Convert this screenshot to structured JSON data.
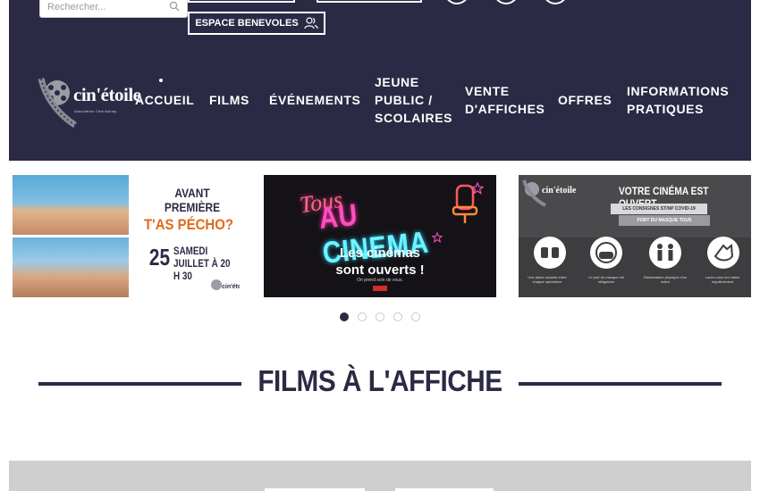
{
  "search": {
    "placeholder": "Rechercher..."
  },
  "header": {
    "espace_label": "ESPACE BENEVOLES",
    "logo_text": "cin'étoile",
    "logo_sub": "Association Ciné Aulnay"
  },
  "nav": [
    {
      "label": "ACCUEIL",
      "active": true
    },
    {
      "label": "FILMS"
    },
    {
      "label": "ÉVÉNEMENTS"
    },
    {
      "label": "JEUNE PUBLIC / SCOLAIRES"
    },
    {
      "label": "VENTE D'AFFICHES"
    },
    {
      "label": "OFFRES"
    },
    {
      "label": "INFORMATIONS PRATIQUES"
    }
  ],
  "slides": {
    "s1": {
      "title": "AVANT PREMIÈRE",
      "headline": "T'AS PÉCHO?",
      "day": "25",
      "date_line1": "SAMEDI",
      "date_line2": "JUILLET À 20 H 30"
    },
    "s2": {
      "tous": "Tous",
      "au": "AU",
      "cinema": "CINEMA",
      "line1": "Les cinémas",
      "line2": "sont ouverts !",
      "small": "On prend soin de vous."
    },
    "s3": {
      "title": "VOTRE CINÉMA EST OUVERT",
      "line1": "LES CONSIGNES ST/NP COVID-19",
      "line2": "PORT DU MASQUE TOUS",
      "caps": [
        "Une place vacante entre chaque spectateur",
        "Le port du masque est obligatoire",
        "Distanciation physique d'un mètre",
        "Lavez-vous les mains régulièrement"
      ]
    }
  },
  "carousel": {
    "count": 5,
    "active_index": 0
  },
  "section": {
    "title": "FILMS À L'AFFICHE"
  },
  "colors": {
    "navy": "#2b2a45",
    "orange": "#e3691a",
    "white": "#ffffff"
  }
}
